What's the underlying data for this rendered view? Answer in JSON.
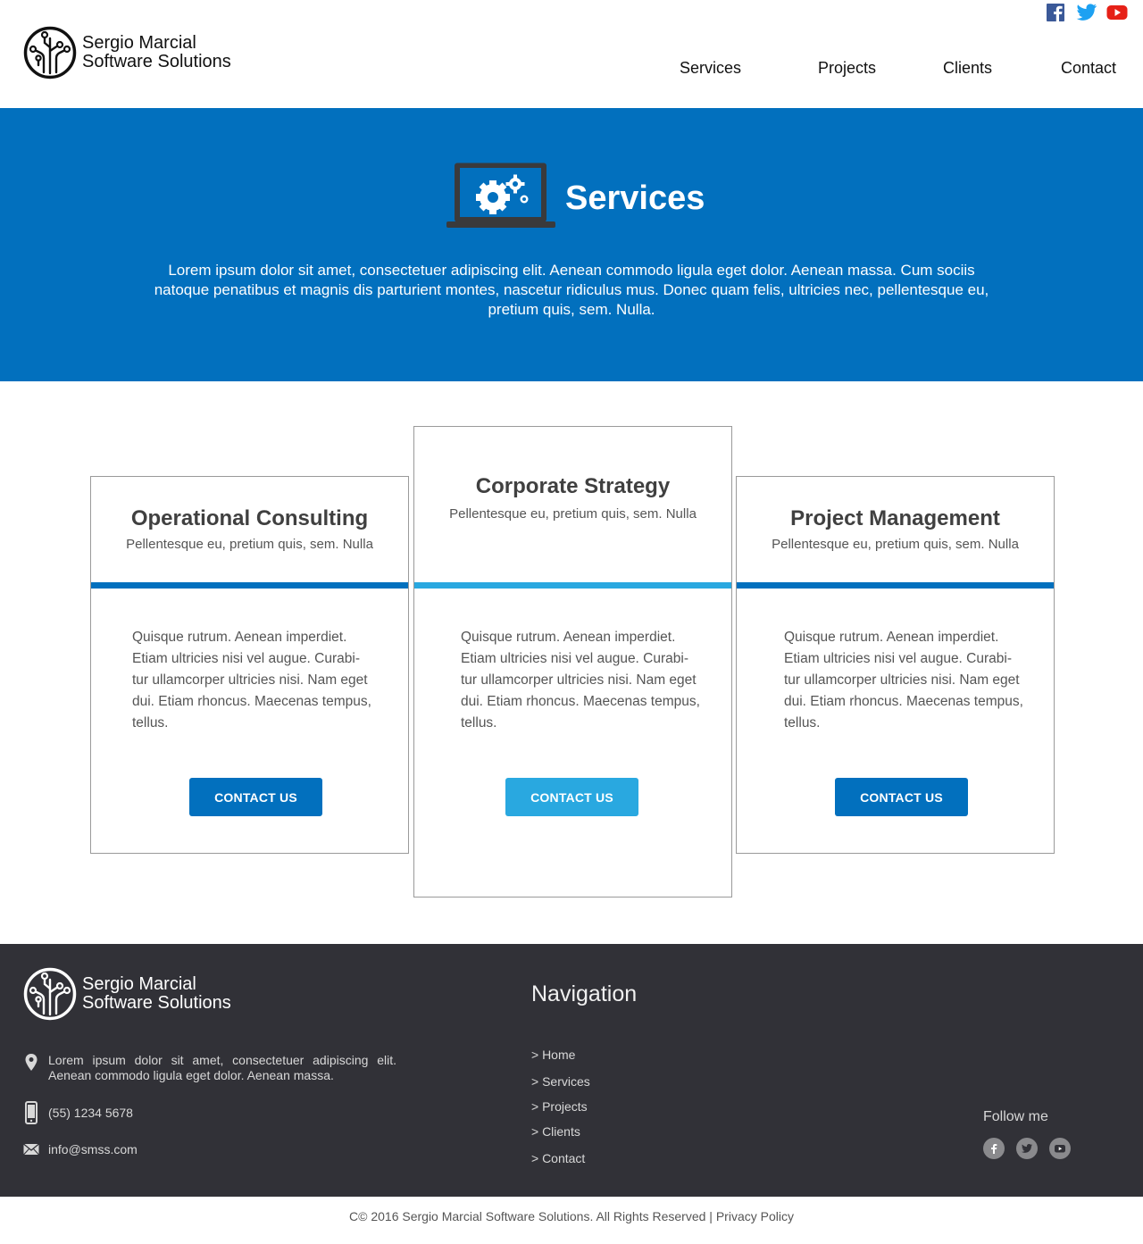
{
  "brand": {
    "line1": "Sergio Marcial",
    "line2": "Software Solutions",
    "colors": {
      "primary": "#0270be",
      "accent": "#29a8e0",
      "dark": "#313137"
    }
  },
  "social_top": [
    "facebook-icon",
    "twitter-icon",
    "youtube-icon"
  ],
  "nav": {
    "services": "Services",
    "projects": "Projects",
    "clients": "Clients",
    "contact": "Contact"
  },
  "hero": {
    "title": "Services",
    "icon": "laptop-gears-icon",
    "text": "Lorem ipsum dolor sit amet, consectetuer adipiscing elit. Aenean commodo ligula eget dolor. Aenean massa. Cum sociis natoque penatibus et magnis dis parturient montes, nascetur ridiculus mus. Donec quam felis, ultricies nec, pellentesque eu, pretium quis, sem. Nulla."
  },
  "cards": [
    {
      "title": "Operational Consulting",
      "subtitle": "Pellentesque eu, pretium quis, sem. Nulla",
      "body": "Quisque rutrum. Aenean imperdiet. Etiam ultricies nisi vel augue. Curabi-tur ullamcorper ultricies nisi. Nam eget dui. Etiam rhoncus. Maecenas tempus, tellus.",
      "button": "CONTACT US",
      "color": "#0270be"
    },
    {
      "title": "Corporate Strategy",
      "subtitle": "Pellentesque eu, pretium quis, sem. Nulla",
      "body": "Quisque rutrum. Aenean imperdiet. Etiam ultricies nisi vel augue. Curabi-tur ullamcorper ultricies nisi. Nam eget dui. Etiam rhoncus. Maecenas tempus, tellus.",
      "button": "CONTACT US",
      "color": "#29a8e0"
    },
    {
      "title": "Project Management",
      "subtitle": "Pellentesque eu, pretium quis, sem. Nulla",
      "body": "Quisque rutrum. Aenean imperdiet. Etiam ultricies nisi vel augue. Curabi-tur ullamcorper ultricies nisi. Nam eget dui. Etiam rhoncus. Maecenas tempus, tellus.",
      "button": "CONTACT US",
      "color": "#0270be"
    }
  ],
  "footer": {
    "address": "Lorem ipsum dolor sit amet, consectetuer adipiscing elit. Aenean commodo ligula eget dolor. Aenean massa.",
    "phone": "(55) 1234 5678",
    "email": "info@smss.com",
    "nav_title": "Navigation",
    "nav_items": [
      "> Home",
      "> Services",
      "> Projects",
      "> Clients",
      "> Contact"
    ],
    "follow": "Follow me"
  },
  "copyright": {
    "text": "C© 2016 Sergio Marcial Software Solutions. All Rights Reserved",
    "separator": "|",
    "privacy": "Privacy Policy"
  }
}
